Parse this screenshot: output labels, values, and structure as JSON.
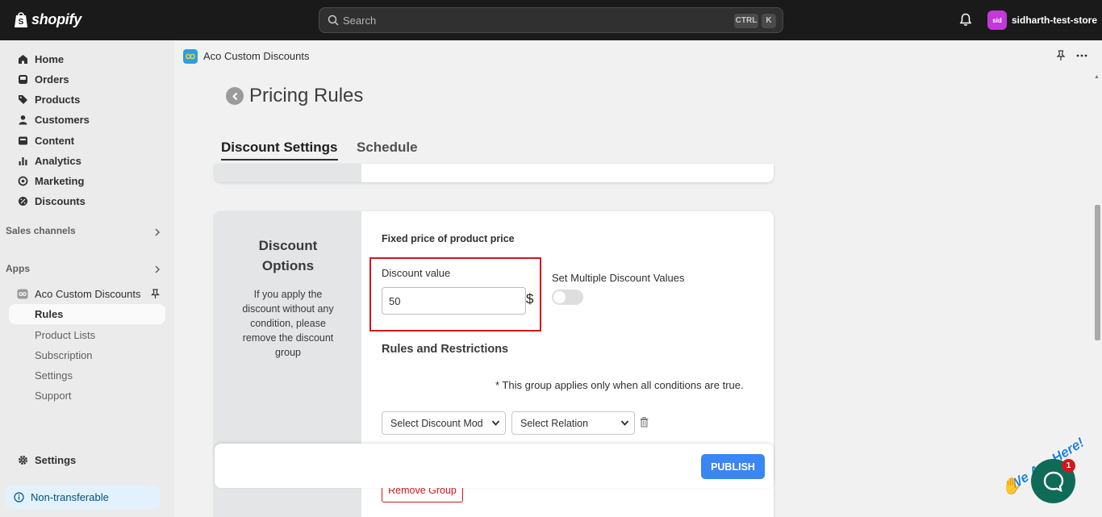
{
  "topbar": {
    "brand": "shopify",
    "search_placeholder": "Search",
    "shortcut_ctrl": "CTRL",
    "shortcut_k": "K",
    "store_avatar": "sid",
    "store_name": "sidharth-test-store"
  },
  "sidebar": {
    "items": [
      {
        "label": "Home",
        "icon": "home-icon"
      },
      {
        "label": "Orders",
        "icon": "orders-icon"
      },
      {
        "label": "Products",
        "icon": "tag-icon"
      },
      {
        "label": "Customers",
        "icon": "person-icon"
      },
      {
        "label": "Content",
        "icon": "content-icon"
      },
      {
        "label": "Analytics",
        "icon": "analytics-icon"
      },
      {
        "label": "Marketing",
        "icon": "target-icon"
      },
      {
        "label": "Discounts",
        "icon": "discount-icon"
      }
    ],
    "sales_channels": "Sales channels",
    "apps": "Apps",
    "app_name": "Aco Custom Discounts",
    "app_subitems": [
      "Rules",
      "Product Lists",
      "Subscription",
      "Settings",
      "Support"
    ],
    "settings": "Settings",
    "non_transferable": "Non-transferable"
  },
  "app_header": {
    "title": "Aco Custom Discounts"
  },
  "page": {
    "title": "Pricing Rules",
    "tabs": [
      "Discount Settings",
      "Schedule"
    ]
  },
  "discount_options": {
    "title": "Discount Options",
    "description": "If you apply the discount without any condition, please remove the discount group",
    "fixed_label": "Fixed price of product price",
    "discount_value_label": "Discount value",
    "discount_value": "50",
    "currency": "$",
    "multi_label": "Set Multiple Discount Values",
    "multi_enabled": false,
    "rules_heading": "Rules and Restrictions",
    "rules_note": "* This group applies only when all conditions are true.",
    "select_mode": "Select Discount Mod",
    "select_relation": "Select Relation",
    "remove_group": "Remove Group"
  },
  "footer": {
    "publish": "PUBLISH"
  },
  "chat": {
    "banner": "We Are Here!",
    "badge": "1"
  },
  "colors": {
    "topbar": "#1a1a1a",
    "primary_button": "#3a86f2",
    "highlight_border": "#d0181b",
    "chat_bubble": "#0f6b57",
    "avatar": "#c239d8"
  }
}
